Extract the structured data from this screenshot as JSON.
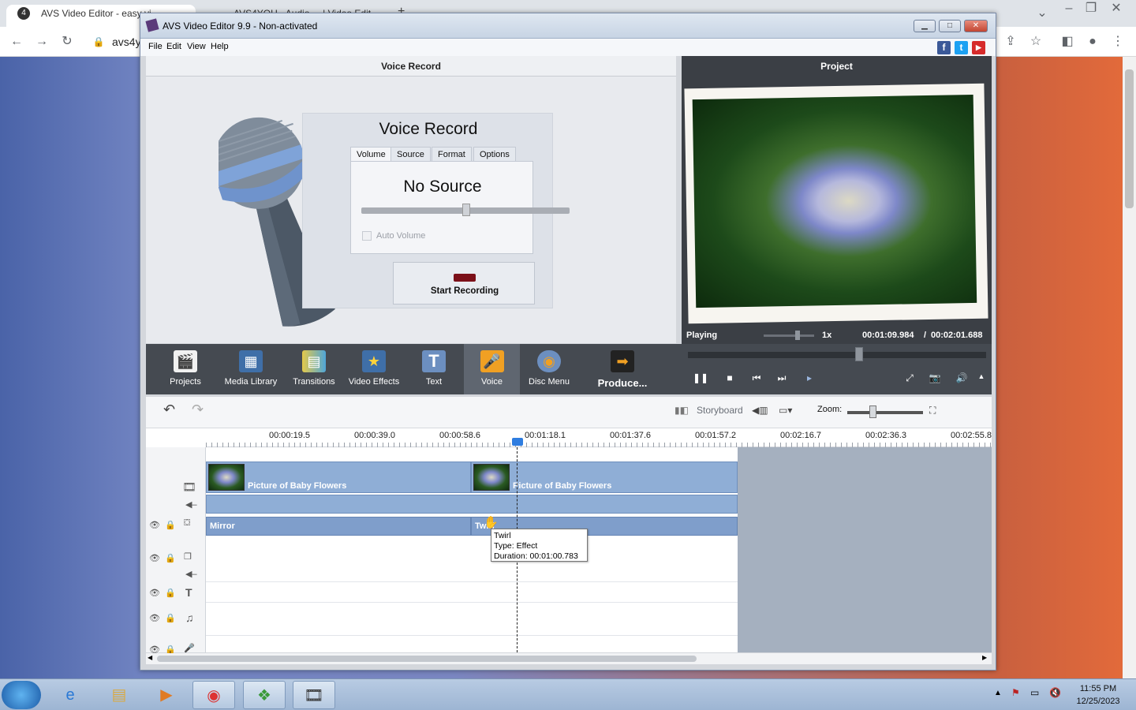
{
  "browser": {
    "tabs": [
      {
        "label": "AVS Video Editor - easy vi"
      },
      {
        "label": "AVS4YOU - Audio ... | Video Edit..."
      }
    ],
    "address": "avs4y",
    "new_tab": "+"
  },
  "window": {
    "title": "AVS Video Editor 9.9 - Non-activated",
    "menu": [
      "File",
      "Edit",
      "View",
      "Help"
    ],
    "social": [
      {
        "name": "facebook",
        "glyph": "f",
        "color": "#3b5998"
      },
      {
        "name": "twitter",
        "glyph": "t",
        "color": "#1da1f2"
      },
      {
        "name": "youtube",
        "glyph": "▶",
        "color": "#d62b2b"
      }
    ]
  },
  "voice_panel": {
    "header": "Voice Record",
    "title": "Voice Record",
    "tabs": [
      "Volume",
      "Source",
      "Format",
      "Options"
    ],
    "active_tab": "Volume",
    "source_text": "No Source",
    "volume_level": 0.5,
    "auto_volume_label": "Auto Volume",
    "auto_volume_checked": false,
    "record_button": "Start Recording"
  },
  "project_panel": {
    "header": "Project",
    "status": "Playing",
    "speed": "1x",
    "current_time": "00:01:09.984",
    "separator": "/",
    "total_time": "00:02:01.688",
    "seek_fraction": 0.58
  },
  "toolbar": {
    "items": [
      {
        "id": "projects",
        "label": "Projects",
        "icon": "clapper-icon"
      },
      {
        "id": "media-library",
        "label": "Media Library",
        "icon": "film-icon"
      },
      {
        "id": "transitions",
        "label": "Transitions",
        "icon": "transitions-icon"
      },
      {
        "id": "video-effects",
        "label": "Video Effects",
        "icon": "star-icon"
      },
      {
        "id": "text",
        "label": "Text",
        "icon": "text-icon"
      },
      {
        "id": "voice",
        "label": "Voice",
        "icon": "microphone-icon",
        "active": true
      },
      {
        "id": "disc-menu",
        "label": "Disc Menu",
        "icon": "disc-icon"
      },
      {
        "id": "produce",
        "label": "Produce...",
        "icon": "produce-icon"
      }
    ]
  },
  "timeline_bar": {
    "storyboard_label": "Storyboard",
    "zoom_label": "Zoom:"
  },
  "timeline": {
    "ruler": [
      "00:00:19.5",
      "00:00:39.0",
      "00:00:58.6",
      "00:01:18.1",
      "00:01:37.6",
      "00:01:57.2",
      "00:02:16.7",
      "00:02:36.3",
      "00:02:55.8"
    ],
    "clips": [
      {
        "title": "Picture of Baby Flowers"
      },
      {
        "title": "Picture of Baby Flowers"
      }
    ],
    "effects": [
      {
        "label": "Mirror"
      },
      {
        "label": "Twirl"
      }
    ],
    "tooltip": {
      "name": "Twirl",
      "type": "Type: Effect",
      "duration": "Duration: 00:01:00.783"
    }
  },
  "taskbar": {
    "clock_time": "11:55 PM",
    "clock_date": "12/25/2023"
  }
}
